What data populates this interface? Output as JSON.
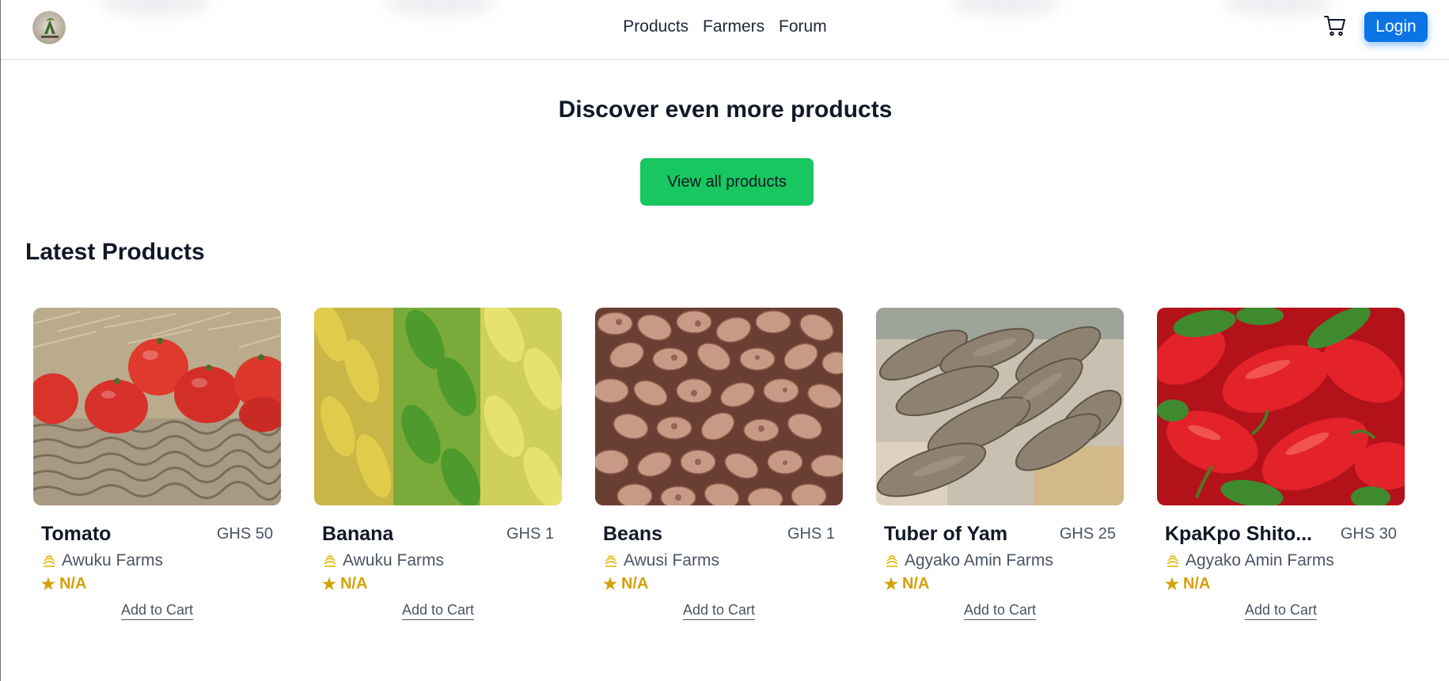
{
  "header": {
    "nav": [
      {
        "label": "Products"
      },
      {
        "label": "Farmers"
      },
      {
        "label": "Forum"
      }
    ],
    "login_label": "Login",
    "icons": {
      "logo": "logo-icon",
      "cart": "shopping-cart-icon"
    },
    "accent_color": "#0b74e5"
  },
  "discover": {
    "title": "Discover even more products",
    "button_label": "View all products",
    "button_color": "#18c75f"
  },
  "latest": {
    "title": "Latest Products",
    "products": [
      {
        "name": "Tomato",
        "price": "GHS 50",
        "farm": "Awuku Farms",
        "rating": "N/A",
        "cart_label": "Add to Cart",
        "image": "tomatoes-in-basket"
      },
      {
        "name": "Banana",
        "price": "GHS 1",
        "farm": "Awuku Farms",
        "rating": "N/A",
        "cart_label": "Add to Cart",
        "image": "banana-bunches"
      },
      {
        "name": "Beans",
        "price": "GHS 1",
        "farm": "Awusi Farms",
        "rating": "N/A",
        "cart_label": "Add to Cart",
        "image": "pinto-beans"
      },
      {
        "name": "Tuber of Yam",
        "price": "GHS 25",
        "farm": "Agyako Amin Farms",
        "rating": "N/A",
        "cart_label": "Add to Cart",
        "image": "yam-tubers"
      },
      {
        "name": "KpaKpo Shito...",
        "price": "GHS 30",
        "farm": "Agyako Amin Farms",
        "rating": "N/A",
        "cart_label": "Add to Cart",
        "image": "red-green-peppers"
      }
    ],
    "rating_color": "#d4a106"
  }
}
